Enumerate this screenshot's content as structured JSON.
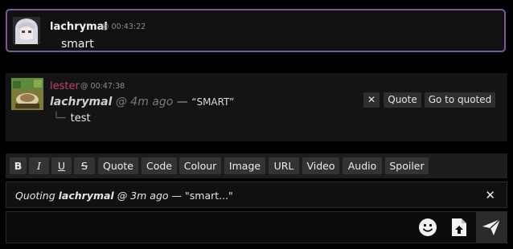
{
  "messages": [
    {
      "username": "lachrymal",
      "timestamp": "@ 00:43:22",
      "text": "smart"
    },
    {
      "username": "lester",
      "timestamp": "@ 00:47:38",
      "quote": {
        "author": "lachrymal",
        "ago": "@ 4m ago",
        "dash": "—",
        "text": "“SMART”"
      },
      "reply_tree": "└─",
      "reply_text": "test",
      "actions": {
        "close": "✕",
        "quote": "Quote",
        "goto": "Go to quoted"
      }
    }
  ],
  "toolbar": {
    "bold": "B",
    "italic": "I",
    "underline": "U",
    "strike": "S",
    "items": [
      "Quote",
      "Code",
      "Colour",
      "Image",
      "URL",
      "Video",
      "Audio",
      "Spoiler"
    ]
  },
  "quoting": {
    "prefix": "Quoting",
    "author": "lachrymal",
    "ago": "@ 3m ago",
    "dash": "—",
    "text": "\"smart...\"",
    "close": "✕"
  },
  "composer": {
    "value": "",
    "placeholder": ""
  },
  "icons": {
    "emoji": "smiley-icon",
    "upload": "file-upload-icon",
    "send": "send-icon"
  }
}
